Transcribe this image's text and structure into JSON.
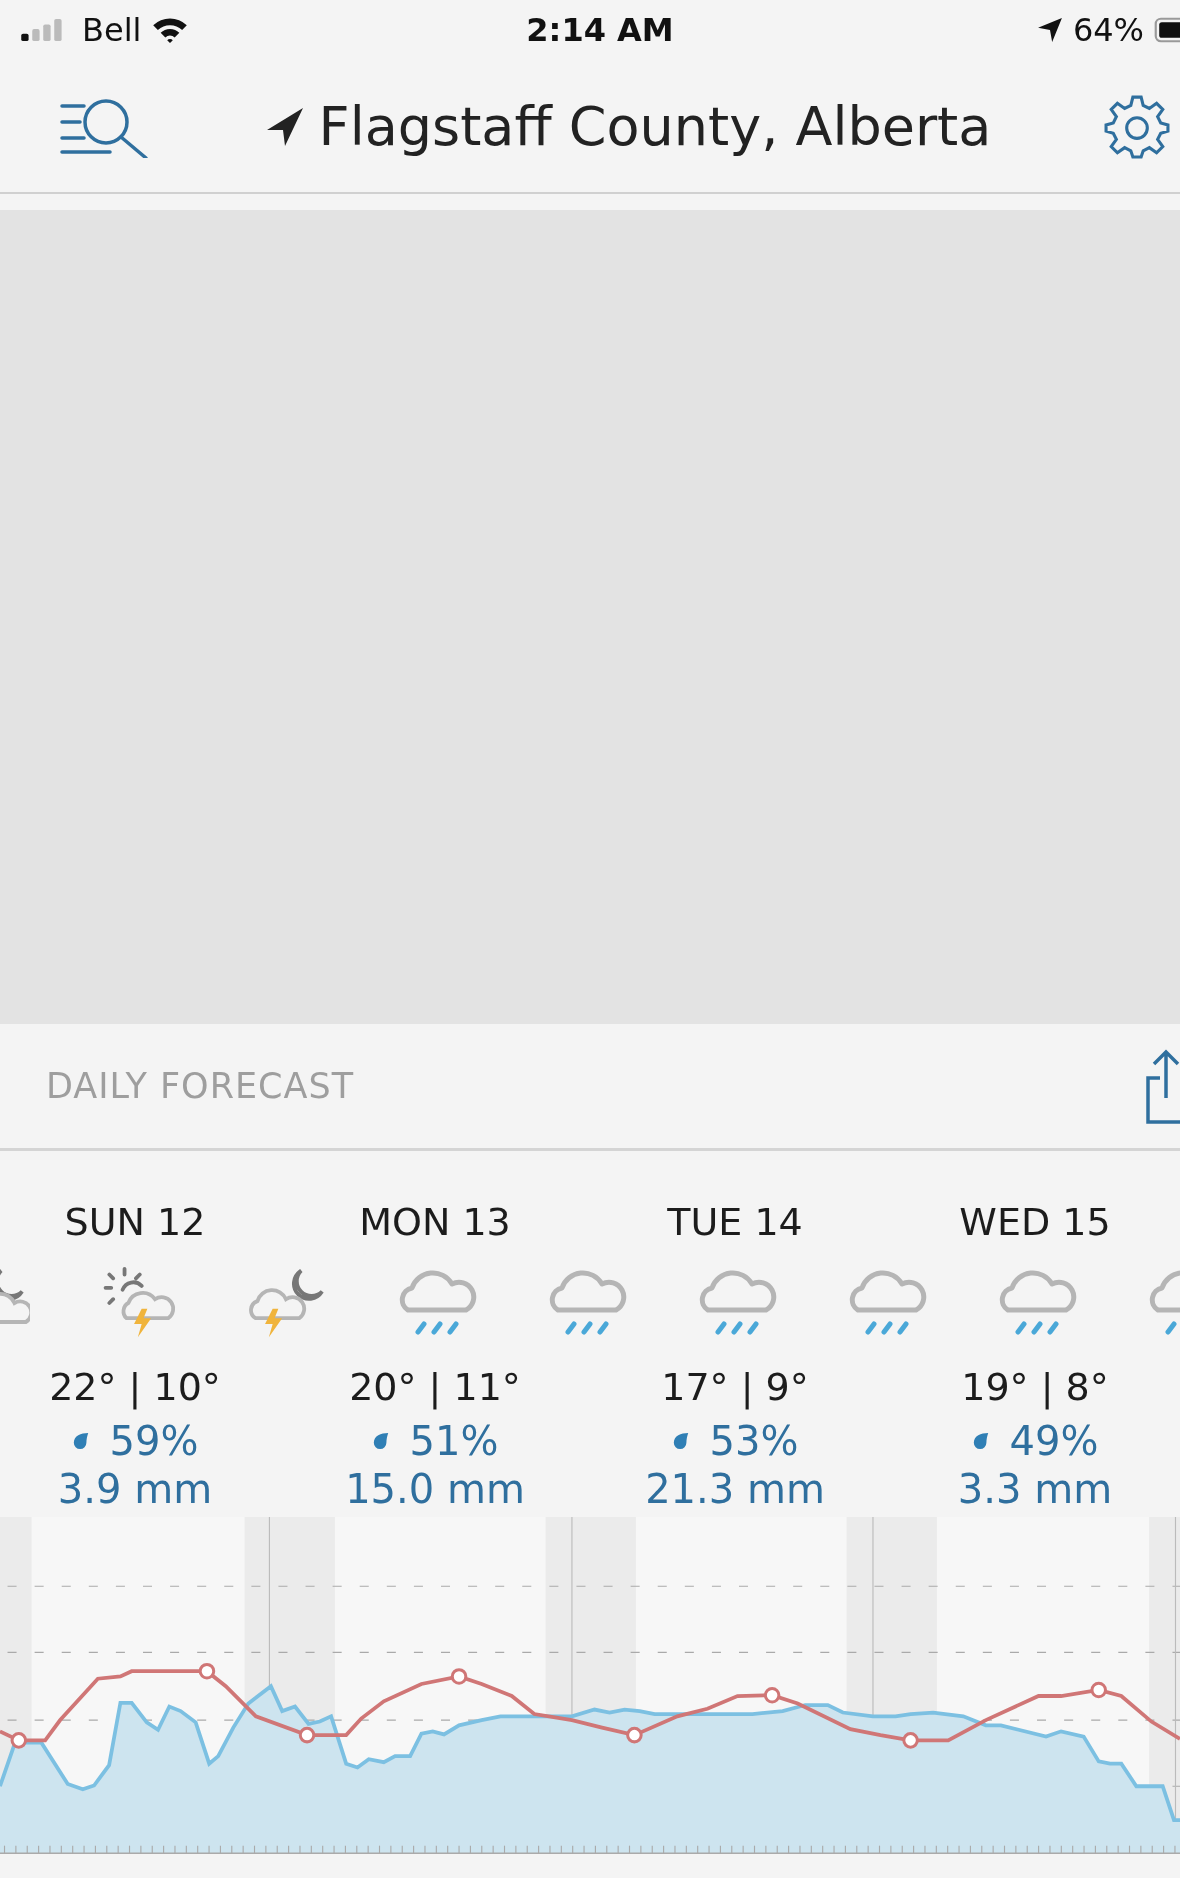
{
  "status_bar": {
    "carrier": "Bell",
    "time": "2:14 AM",
    "battery": "64%"
  },
  "header": {
    "location": "Flagstaff County, Alberta"
  },
  "section": {
    "title": "DAILY FORECAST"
  },
  "icons": [
    {
      "kind": "moon-cloud"
    },
    {
      "kind": "sun-storm"
    },
    {
      "kind": "moon-storm"
    },
    {
      "kind": "rain"
    },
    {
      "kind": "rain"
    },
    {
      "kind": "rain"
    },
    {
      "kind": "rain"
    },
    {
      "kind": "rain"
    },
    {
      "kind": "rain"
    }
  ],
  "days": [
    {
      "label": "SUN 12",
      "temps": "22° | 10°",
      "pop": "59%",
      "amount": "3.9 mm"
    },
    {
      "label": "MON 13",
      "temps": "20° | 11°",
      "pop": "51%",
      "amount": "15.0 mm"
    },
    {
      "label": "TUE 14",
      "temps": "17° | 9°",
      "pop": "53%",
      "amount": "21.3 mm"
    },
    {
      "label": "WED 15",
      "temps": "19° | 8°",
      "pop": "49%",
      "amount": "3.3 mm"
    }
  ]
}
